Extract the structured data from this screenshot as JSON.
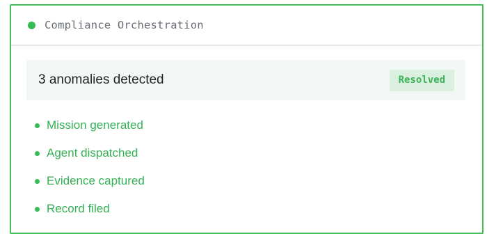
{
  "panel": {
    "title": "Compliance Orchestration",
    "accent_color": "#43c05a",
    "status_dot_icon": "status-dot-icon"
  },
  "summary": {
    "text": "3 anomalies detected",
    "badge": "Resolved"
  },
  "steps": [
    {
      "label": "Mission generated"
    },
    {
      "label": "Agent dispatched"
    },
    {
      "label": "Evidence captured"
    },
    {
      "label": "Record filed"
    }
  ]
}
